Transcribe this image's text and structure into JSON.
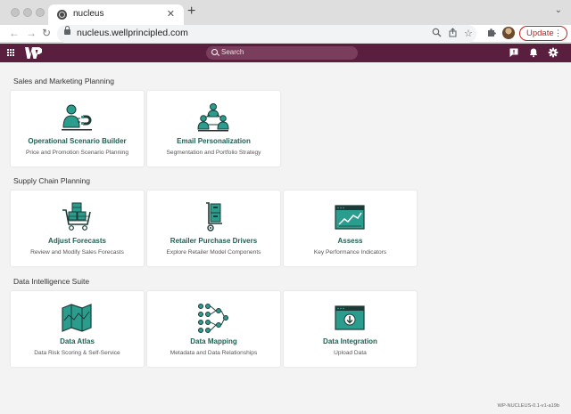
{
  "browser": {
    "tab_title": "nucleus",
    "url": "nucleus.wellprincipled.com",
    "update_label": "Update"
  },
  "app": {
    "search_placeholder": "Search",
    "brand_color": "#5a1e3e",
    "accent_color": "#1f5f52"
  },
  "sections": [
    {
      "title": "Sales and Marketing Planning",
      "cards": [
        {
          "title": "Operational Scenario Builder",
          "subtitle": "Price and Promotion Scenario Planning",
          "icon": "magnet-person-icon"
        },
        {
          "title": "Email Personalization",
          "subtitle": "Segmentation and Portfolio Strategy",
          "icon": "people-network-icon"
        }
      ]
    },
    {
      "title": "Supply Chain Planning",
      "cards": [
        {
          "title": "Adjust Forecasts",
          "subtitle": "Review and Modify Sales Forecasts",
          "icon": "shopping-cart-icon"
        },
        {
          "title": "Retailer Purchase Drivers",
          "subtitle": "Explore Retailer Model Components",
          "icon": "hand-truck-icon"
        },
        {
          "title": "Assess",
          "subtitle": "Key Performance Indicators",
          "icon": "chart-window-icon"
        }
      ]
    },
    {
      "title": "Data Intelligence Suite",
      "cards": [
        {
          "title": "Data Atlas",
          "subtitle": "Data Risk Scoring & Self-Service",
          "icon": "map-icon"
        },
        {
          "title": "Data Mapping",
          "subtitle": "Metadata and Data Relationships",
          "icon": "data-nodes-icon"
        },
        {
          "title": "Data Integration",
          "subtitle": "Upload Data",
          "icon": "upload-window-icon"
        }
      ]
    }
  ],
  "version": "WP-NUCLEUS-0.1-v1-a19b"
}
